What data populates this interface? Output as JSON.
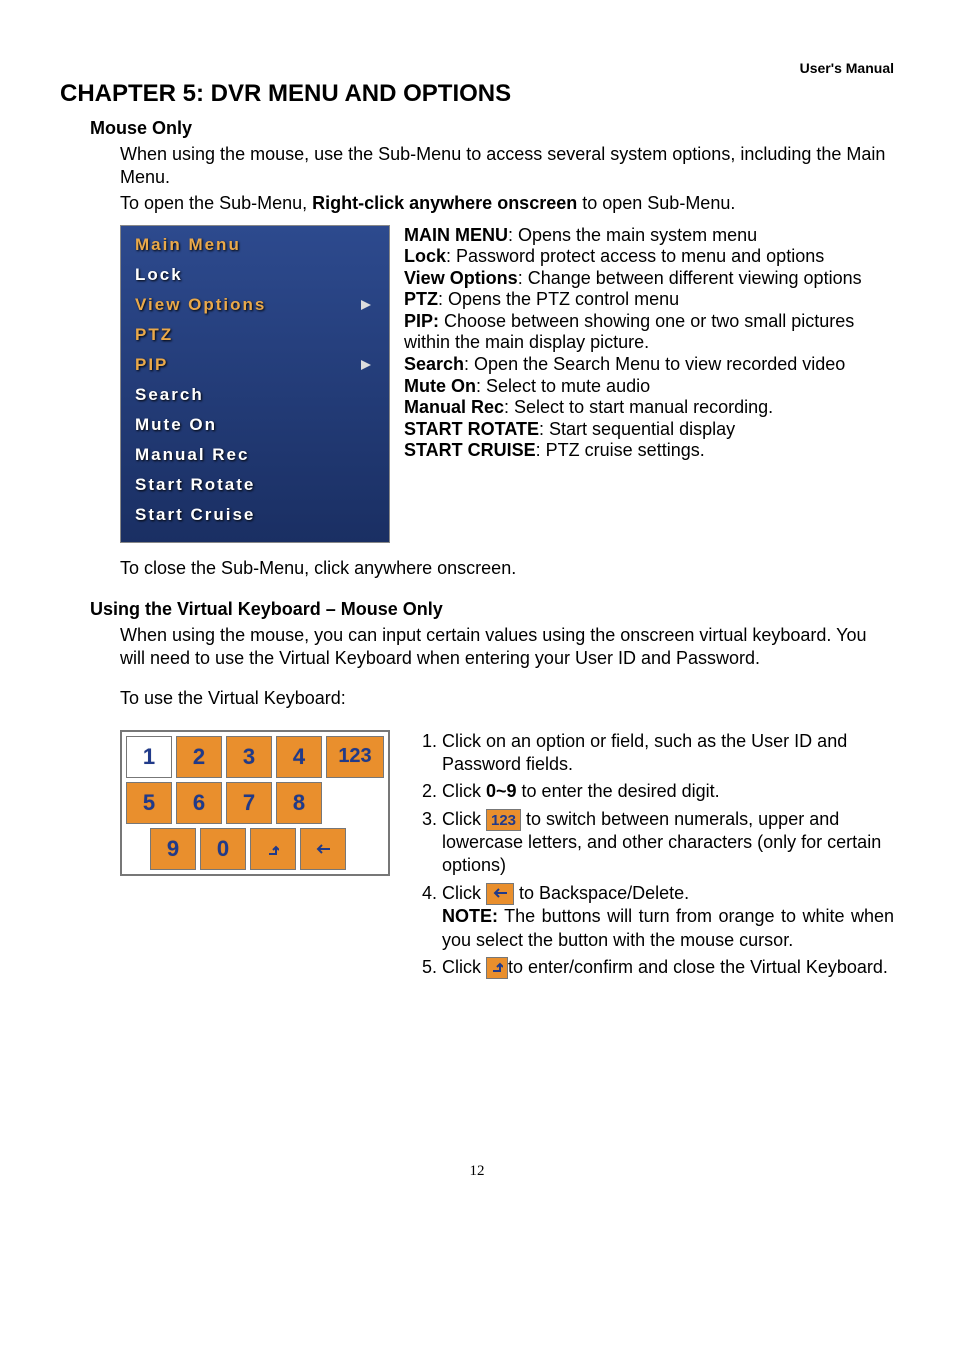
{
  "header": {
    "manual": "User's Manual"
  },
  "chapter": {
    "title": "CHAPTER 5: DVR MENU AND OPTIONS"
  },
  "section1": {
    "title": "Mouse Only",
    "p1": "When using the mouse, use the Sub-Menu to access several system options, including the Main Menu.",
    "p2a": "To open the Sub-Menu, ",
    "p2b": "Right-click anywhere onscreen",
    "p2c": " to open Sub-Menu."
  },
  "submenu": {
    "items": [
      {
        "label": "Main  Menu",
        "hl": true,
        "arrow": false
      },
      {
        "label": "Lock",
        "hl": false,
        "arrow": false
      },
      {
        "label": "View  Options",
        "hl": true,
        "arrow": true
      },
      {
        "label": "PTZ",
        "hl": true,
        "arrow": false
      },
      {
        "label": "PIP",
        "hl": true,
        "arrow": true
      },
      {
        "label": "Search",
        "hl": false,
        "arrow": false
      },
      {
        "label": "Mute  On",
        "hl": false,
        "arrow": false
      },
      {
        "label": "Manual  Rec",
        "hl": false,
        "arrow": false
      },
      {
        "label": "Start  Rotate",
        "hl": false,
        "arrow": false
      },
      {
        "label": "Start  Cruise",
        "hl": false,
        "arrow": false
      }
    ]
  },
  "desc": {
    "main_menu_b": "MAIN MENU",
    "main_menu_t": ": Opens the main system menu",
    "lock_b": "Lock",
    "lock_t": ": Password protect access to menu and options",
    "view_b": "View Options",
    "view_t": ": Change between different viewing options",
    "ptz_b": "PTZ",
    "ptz_t": ": Opens the PTZ control menu",
    "pip_b": "PIP:",
    "pip_t": " Choose between showing one or two small pictures within the main display picture.",
    "search_b": "Search",
    "search_t": ": Open the Search Menu to view recorded video",
    "mute_b": "Mute On",
    "mute_t": ": Select to mute audio",
    "manrec_b": "Manual Rec",
    "manrec_t": ": Select to start manual recording.",
    "rotate_b": "START ROTATE",
    "rotate_t": ": Start sequential display",
    "cruise_b": "START CRUISE",
    "cruise_t": ": PTZ cruise settings."
  },
  "section1_close": "To close the Sub-Menu, click anywhere onscreen.",
  "section2": {
    "title": "Using the Virtual Keyboard – Mouse Only",
    "p1": "When using the mouse, you can input certain values using the onscreen virtual keyboard. You will need to use the Virtual Keyboard when entering your User ID and Password.",
    "p2": "To use the Virtual Keyboard:"
  },
  "keyboard": {
    "rows": [
      [
        "1",
        "2",
        "3",
        "4",
        "123"
      ],
      [
        "5",
        "6",
        "7",
        "8"
      ],
      [
        "9",
        "0",
        "enter",
        "back"
      ]
    ]
  },
  "steps": {
    "s1": "Click on an option or field, such as the User ID and Password fields.",
    "s2a": "Click ",
    "s2b": "0~9",
    "s2c": " to enter the desired digit.",
    "s3a": "Click ",
    "s3icon": "123",
    "s3b": "to switch between numerals, upper and lowercase letters, and other characters (only for certain options)",
    "s4a": "Click ",
    "s4b": "  to Backspace/Delete.",
    "note_b": "NOTE:",
    "note_t": " The buttons will turn from orange to white when you select the button with the mouse cursor.",
    "s5a": "Click ",
    "s5b": "to enter/confirm and close the Virtual Keyboard."
  },
  "page_number": "12"
}
